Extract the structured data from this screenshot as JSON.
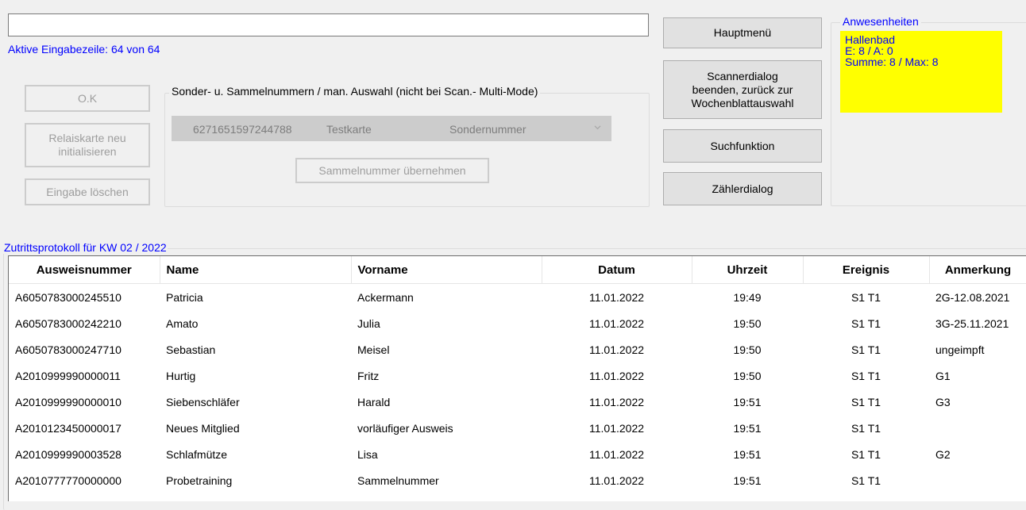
{
  "entry": {
    "value": "",
    "status_label": "Aktive Eingabezeile: 64 von 64"
  },
  "buttons": {
    "ok": "O.K",
    "relay_line1": "Relaiskarte  neu",
    "relay_line2": "initialisieren",
    "clear": "Eingabe löschen",
    "main_menu": "Hauptmenü",
    "scanner_line1": "Scannerdialog",
    "scanner_line2": "beenden, zurück zur",
    "scanner_line3": "Wochenblattauswahl",
    "search": "Suchfunktion",
    "counter": "Zählerdialog",
    "take_collective": "Sammelnummer übernehmen"
  },
  "special_group": {
    "title": "Sonder- u.  Sammelnummern / man.  Auswahl (nicht bei Scan.- Multi-Mode)",
    "select": {
      "number": "6271651597244788",
      "name": "Testkarte",
      "type": "Sondernummer"
    }
  },
  "attendance": {
    "title": "Anwesenheiten",
    "location": "Hallenbad",
    "entries": "E: 8 / A: 0",
    "sum": "Summe: 8 / Max: 8"
  },
  "log": {
    "title": "Zutrittsprotokoll für KW 02 / 2022",
    "columns": [
      "Ausweisnummer",
      "Name",
      "Vorname",
      "Datum",
      "Uhrzeit",
      "Ereignis",
      "Anmerkung"
    ],
    "rows": [
      [
        "A6050783000245510",
        "Patricia",
        "Ackermann",
        "11.01.2022",
        "19:49",
        "S1 T1",
        "2G-12.08.2021"
      ],
      [
        "A6050783000242210",
        "Amato",
        "Julia",
        "11.01.2022",
        "19:50",
        "S1 T1",
        "3G-25.11.2021"
      ],
      [
        "A6050783000247710",
        "Sebastian",
        "Meisel",
        "11.01.2022",
        "19:50",
        "S1 T1",
        "ungeimpft"
      ],
      [
        "A2010999990000011",
        "Hurtig",
        "Fritz",
        "11.01.2022",
        "19:50",
        "S1 T1",
        "G1"
      ],
      [
        "A2010999990000010",
        "Siebenschläfer",
        "Harald",
        "11.01.2022",
        "19:51",
        "S1 T1",
        "G3"
      ],
      [
        "A2010123450000017",
        "Neues Mitglied",
        "vorläufiger Ausweis",
        "11.01.2022",
        "19:51",
        "S1 T1",
        ""
      ],
      [
        "A2010999990003528",
        "Schlafmütze",
        "Lisa",
        "11.01.2022",
        "19:51",
        "S1 T1",
        "G2"
      ],
      [
        "A2010777770000000",
        "Probetraining",
        "Sammelnummer",
        "11.01.2022",
        "19:51",
        "S1 T1",
        ""
      ]
    ]
  }
}
